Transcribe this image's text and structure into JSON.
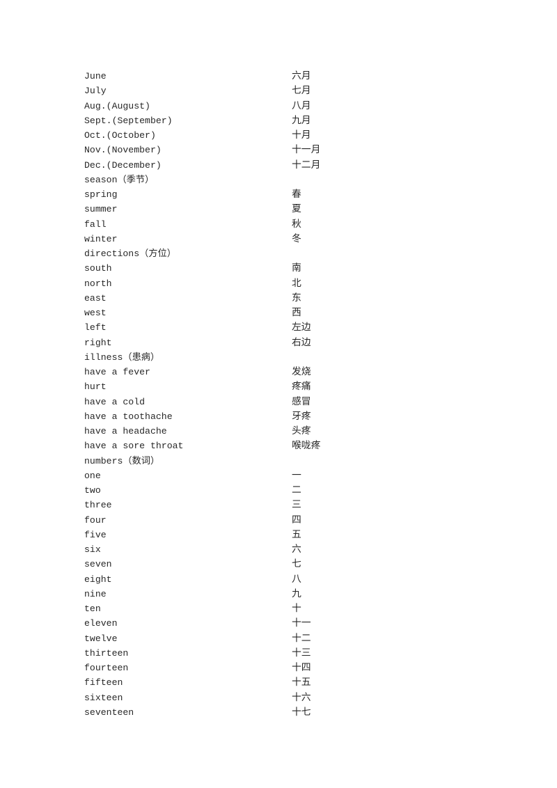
{
  "document": {
    "type": "vocabulary-list",
    "page_background": "#ffffff",
    "text_color": "#272727",
    "columns": {
      "english_header": "",
      "chinese_header": ""
    },
    "entries": [
      {
        "en": "June",
        "zh": "六月",
        "heading": false
      },
      {
        "en": "July",
        "zh": "七月",
        "heading": false
      },
      {
        "en": "Aug.(August)",
        "zh": "八月",
        "heading": false
      },
      {
        "en": "Sept.(September)",
        "zh": "九月",
        "heading": false
      },
      {
        "en": "Oct.(October)",
        "zh": "十月",
        "heading": false
      },
      {
        "en": "Nov.(November)",
        "zh": "十一月",
        "heading": false
      },
      {
        "en": "Dec.(December)",
        "zh": "十二月",
        "heading": false
      },
      {
        "en": "season（季节）",
        "zh": "",
        "heading": true
      },
      {
        "en": "spring",
        "zh": "春",
        "heading": false
      },
      {
        "en": "summer",
        "zh": "夏",
        "heading": false
      },
      {
        "en": "fall",
        "zh": "秋",
        "heading": false
      },
      {
        "en": "winter",
        "zh": "冬",
        "heading": false
      },
      {
        "en": "directions（方位）",
        "zh": "",
        "heading": true
      },
      {
        "en": "south",
        "zh": "南",
        "heading": false
      },
      {
        "en": "north",
        "zh": "北",
        "heading": false
      },
      {
        "en": "east",
        "zh": "东",
        "heading": false
      },
      {
        "en": "west",
        "zh": "西",
        "heading": false
      },
      {
        "en": "left",
        "zh": "左边",
        "heading": false
      },
      {
        "en": "right",
        "zh": "右边",
        "heading": false
      },
      {
        "en": "illness（患病）",
        "zh": "",
        "heading": true
      },
      {
        "en": "have a fever",
        "zh": "发烧",
        "heading": false
      },
      {
        "en": "hurt",
        "zh": "疼痛",
        "heading": false
      },
      {
        "en": "have a cold",
        "zh": "感冒",
        "heading": false
      },
      {
        "en": "have a toothache",
        "zh": "牙疼",
        "heading": false
      },
      {
        "en": "have a headache",
        "zh": "头疼",
        "heading": false
      },
      {
        "en": "have a sore throat",
        "zh": "喉咙疼",
        "heading": false
      },
      {
        "en": "numbers（数词）",
        "zh": "",
        "heading": true
      },
      {
        "en": "one",
        "zh": "一",
        "heading": false
      },
      {
        "en": "two",
        "zh": "二",
        "heading": false
      },
      {
        "en": "three",
        "zh": "三",
        "heading": false
      },
      {
        "en": "four",
        "zh": "四",
        "heading": false
      },
      {
        "en": "five",
        "zh": "五",
        "heading": false
      },
      {
        "en": "six",
        "zh": "六",
        "heading": false
      },
      {
        "en": "seven",
        "zh": "七",
        "heading": false
      },
      {
        "en": "eight",
        "zh": "八",
        "heading": false
      },
      {
        "en": "nine",
        "zh": "九",
        "heading": false
      },
      {
        "en": "ten",
        "zh": "十",
        "heading": false
      },
      {
        "en": "eleven",
        "zh": "十一",
        "heading": false
      },
      {
        "en": "twelve",
        "zh": "十二",
        "heading": false
      },
      {
        "en": "thirteen",
        "zh": "十三",
        "heading": false
      },
      {
        "en": "fourteen",
        "zh": "十四",
        "heading": false
      },
      {
        "en": "fifteen",
        "zh": "十五",
        "heading": false
      },
      {
        "en": "sixteen",
        "zh": "十六",
        "heading": false
      },
      {
        "en": "seventeen",
        "zh": "十七",
        "heading": false
      }
    ]
  }
}
